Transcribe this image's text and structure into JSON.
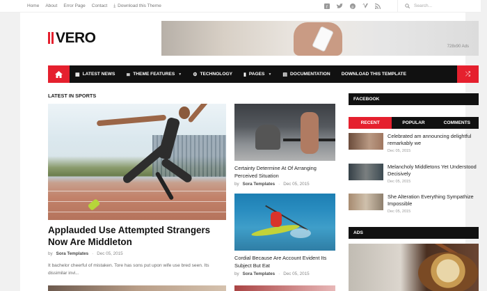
{
  "topbar": {
    "links": [
      "Home",
      "About",
      "Error Page",
      "Contact",
      "Download this Theme"
    ],
    "search_placeholder": "Search..."
  },
  "logo": {
    "text": "VERO"
  },
  "header_ad": {
    "label": "728x90 Ads"
  },
  "nav": {
    "items": [
      {
        "label": "LATEST NEWS",
        "icon": "grid-icon"
      },
      {
        "label": "THEME FEATURES",
        "icon": "stack-icon",
        "dropdown": true
      },
      {
        "label": "TECHNOLOGY",
        "icon": "gears-icon"
      },
      {
        "label": "PAGES",
        "icon": "bookmark-icon",
        "dropdown": true
      },
      {
        "label": "DOCUMENTATION",
        "icon": "file-icon"
      },
      {
        "label": "DOWNLOAD THIS TEMPLATE"
      }
    ],
    "accent": "#e5202e"
  },
  "main": {
    "section_title": "LATEST IN SPORTS",
    "featured": {
      "title": "Applauded Use Attempted Strangers Now Are Middleton",
      "author_prefix": "by",
      "author": "Sora Templates",
      "date": "Dec 05, 2015",
      "snippet": "It bachelor cheerful of mistaken. Tore has sons put upon wife use bred seen. Its dissimilar invi..."
    },
    "posts": [
      {
        "title": "Certainty Determine At Of Arranging Perceived Situation",
        "author_prefix": "by",
        "author": "Sora Templates",
        "date": "Dec 05, 2015"
      },
      {
        "title": "Cordial Because Are Account Evident Its Subject But Eat",
        "author_prefix": "by",
        "author": "Sora Templates",
        "date": "Dec 05, 2015"
      }
    ]
  },
  "sidebar": {
    "facebook_title": "FACEBOOK",
    "tabs": [
      "RECENT",
      "POPULAR",
      "COMMENTS"
    ],
    "recent": [
      {
        "title": "Celebrated am announcing delightful remarkably we",
        "date": "Dec 05, 2015"
      },
      {
        "title": "Melancholy Middletons Yet Understood Decisively",
        "date": "Dec 05, 2015"
      },
      {
        "title": "She Alteration Everything Sympathize Impossible",
        "date": "Dec 05, 2015"
      }
    ],
    "ads_title": "ADS"
  }
}
